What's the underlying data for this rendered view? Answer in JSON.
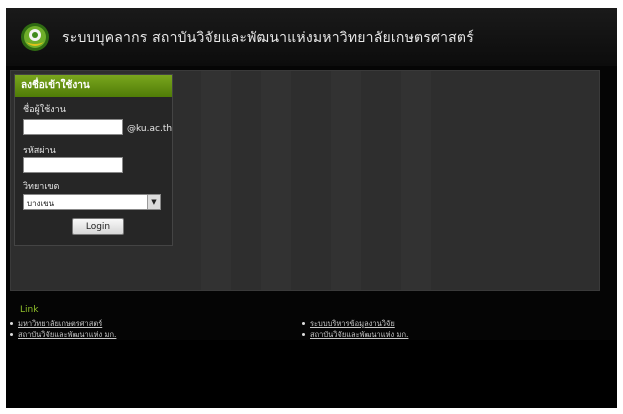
{
  "header": {
    "title": "ระบบบุคลากร สถาบันวิจัยและพัฒนาแห่งมหาวิทยาลัยเกษตรศาสตร์",
    "logo_icon": "ku-logo"
  },
  "login": {
    "heading": "ลงชื่อเข้าใช้งาน",
    "username_label": "ชื่อผู้ใช้งาน",
    "username_value": "",
    "domain_suffix": "@ku.ac.th",
    "password_label": "รหัสผ่าน",
    "password_value": "",
    "campus_label": "วิทยาเขต",
    "campus_selected": "บางเขน",
    "button_label": "Login"
  },
  "links": {
    "title": "Link",
    "left": [
      "มหาวิทยาลัยเกษตรศาสตร์",
      "สถาบันวิจัยและพัฒนาแห่ง มก."
    ],
    "right": [
      "ระบบบริหารข้อมูลงานวิจัย",
      "สถาบันวิจัยและพัฒนาแห่ง มก."
    ]
  },
  "colors": {
    "accent_green": "#5e8c0f",
    "background": "#050505",
    "panel": "#2e2e2e"
  }
}
